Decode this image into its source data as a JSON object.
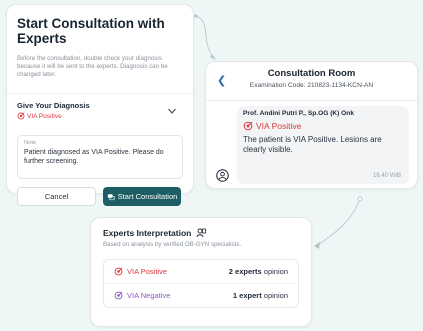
{
  "consultation": {
    "title": "Start Consultation with Experts",
    "description": "Before the consultation, double check your diagnosis because it will be sent to the experts. Diagnosis can be changed later.",
    "diagnosis_label": "Give Your Diagnosis",
    "diagnosis_value": "VIA Positive",
    "note_label": "Note",
    "note_value": "Patient diagnosed as VIA Positive. Please do further screening.",
    "cancel_label": "Cancel",
    "start_label": "Start Consultation"
  },
  "room": {
    "title": "Consultation Room",
    "exam_code": "Examination Code: 210823-1134-KCN-AN",
    "message": {
      "sender": "Prof. Andini Putri P., Sp.OG (K) Onk",
      "status": "VIA Positive",
      "body": "The patient is VIA Positive. Lesions are clearly visible.",
      "time": "16.40 WIB"
    }
  },
  "experts": {
    "title": "Experts Interpretation",
    "description": "Based on analysis by verified OB-GYN specialists.",
    "rows": [
      {
        "status": "VIA Positive",
        "count": "2 experts",
        "suffix": "opinion",
        "color": "#d9383f"
      },
      {
        "status": "VIA Negative",
        "count": "1 expert",
        "suffix": "opinion",
        "color": "#8b5cc6"
      }
    ]
  },
  "colors": {
    "positive": "#d9383f",
    "negative": "#8b5cc6",
    "primary_button": "#1d5e64",
    "link": "#2b6cb0"
  },
  "icons": [
    "chevron-down-icon",
    "target-icon",
    "chat-icon",
    "back-arrow-icon",
    "doctor-avatar-icon",
    "expert-badge-icon"
  ]
}
